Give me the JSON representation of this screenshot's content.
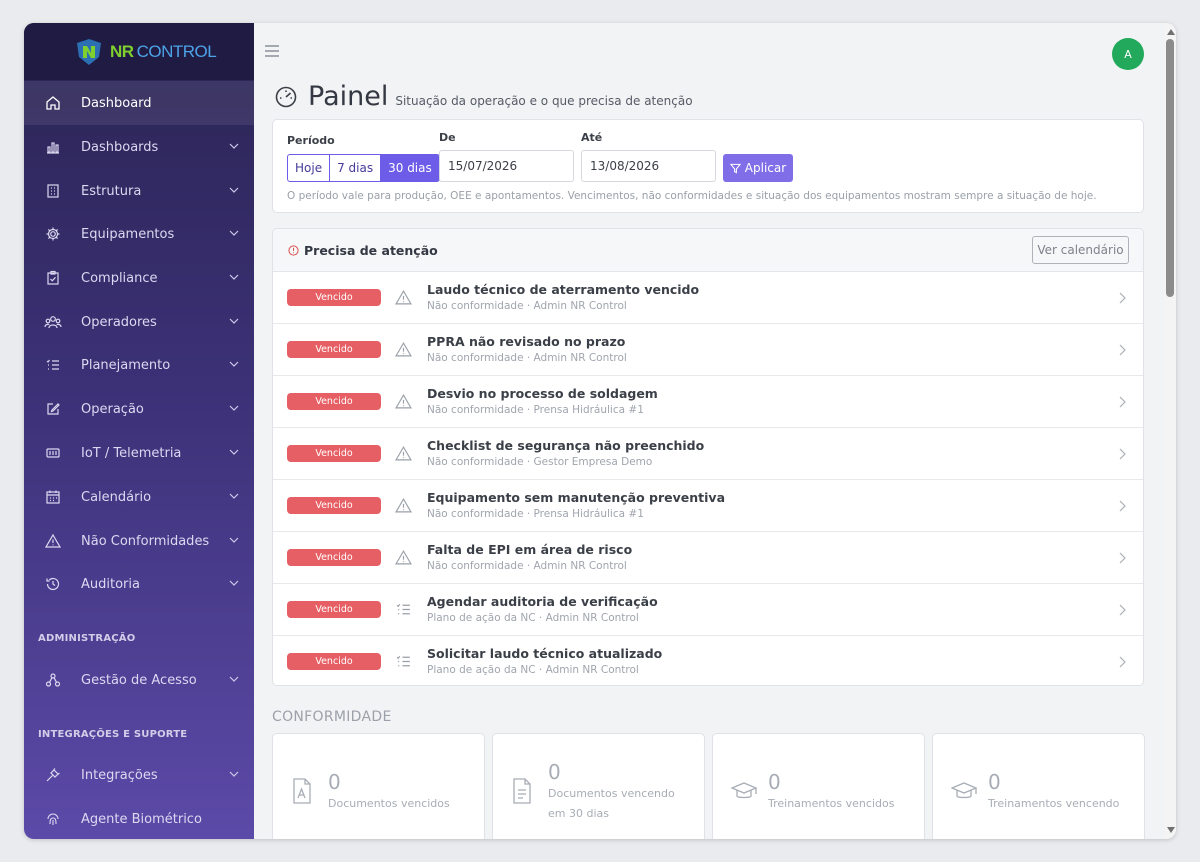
{
  "brand": {
    "part1": "NR",
    "part2": "CONTROL"
  },
  "sidebar": {
    "items": [
      {
        "label": "Dashboard",
        "icon": "home-icon"
      },
      {
        "label": "Dashboards",
        "icon": "bar-chart-icon"
      },
      {
        "label": "Estrutura",
        "icon": "building-icon"
      },
      {
        "label": "Equipamentos",
        "icon": "gear-icon"
      },
      {
        "label": "Compliance",
        "icon": "clipboard-check-icon"
      },
      {
        "label": "Operadores",
        "icon": "users-icon"
      },
      {
        "label": "Planejamento",
        "icon": "list-icon"
      },
      {
        "label": "Operação",
        "icon": "edit-icon"
      },
      {
        "label": "IoT / Telemetria",
        "icon": "chip-icon"
      },
      {
        "label": "Calendário",
        "icon": "calendar-icon"
      },
      {
        "label": "Não Conformidades",
        "icon": "warning-icon"
      },
      {
        "label": "Auditoria",
        "icon": "history-icon"
      }
    ],
    "section_admin": "ADMINISTRAÇÃO",
    "admin_items": [
      {
        "label": "Gestão de Acesso",
        "icon": "diagram-icon"
      }
    ],
    "section_integrations": "INTEGRAÇÕES E SUPORTE",
    "integration_items": [
      {
        "label": "Integrações",
        "icon": "plug-icon"
      },
      {
        "label": "Agente Biométrico",
        "icon": "fingerprint-icon"
      }
    ]
  },
  "header": {
    "avatar_initial": "A"
  },
  "page": {
    "title": "Painel",
    "subtitle": "Situação da operação e o que precisa de atenção"
  },
  "period": {
    "label": "Período",
    "options": [
      "Hoje",
      "7 dias",
      "30 dias"
    ],
    "selected": "30 dias",
    "from_label": "De",
    "from_value": "15/07/2026",
    "to_label": "Até",
    "to_value": "13/08/2026",
    "apply_label": "Aplicar",
    "hint": "O período vale para produção, OEE e apontamentos. Vencimentos, não conformidades e situação dos equipamentos mostram sempre a situação de hoje."
  },
  "attention": {
    "title": "Precisa de atenção",
    "calendar_button": "Ver calendário",
    "rows": [
      {
        "badge": "Vencido",
        "icon": "warning-icon",
        "title": "Laudo técnico de aterramento vencido",
        "sub": "Não conformidade · Admin NR Control"
      },
      {
        "badge": "Vencido",
        "icon": "warning-icon",
        "title": "PPRA não revisado no prazo",
        "sub": "Não conformidade · Admin NR Control"
      },
      {
        "badge": "Vencido",
        "icon": "warning-icon",
        "title": "Desvio no processo de soldagem",
        "sub": "Não conformidade · Prensa Hidráulica #1"
      },
      {
        "badge": "Vencido",
        "icon": "warning-icon",
        "title": "Checklist de segurança não preenchido",
        "sub": "Não conformidade · Gestor Empresa Demo"
      },
      {
        "badge": "Vencido",
        "icon": "warning-icon",
        "title": "Equipamento sem manutenção preventiva",
        "sub": "Não conformidade · Prensa Hidráulica #1"
      },
      {
        "badge": "Vencido",
        "icon": "warning-icon",
        "title": "Falta de EPI em área de risco",
        "sub": "Não conformidade · Admin NR Control"
      },
      {
        "badge": "Vencido",
        "icon": "list-icon",
        "title": "Agendar auditoria de verificação",
        "sub": "Plano de ação da NC · Admin NR Control"
      },
      {
        "badge": "Vencido",
        "icon": "list-icon",
        "title": "Solicitar laudo técnico atualizado",
        "sub": "Plano de ação da NC · Admin NR Control"
      }
    ]
  },
  "compliance": {
    "title": "CONFORMIDADE",
    "cards": [
      {
        "value": "0",
        "label": "Documentos vencidos",
        "icon": "pdf-icon"
      },
      {
        "value": "0",
        "label": "Documentos vencendo em 30 dias",
        "icon": "document-icon"
      },
      {
        "value": "0",
        "label": "Treinamentos vencidos",
        "icon": "graduation-cap-icon"
      },
      {
        "value": "0",
        "label": "Treinamentos vencendo",
        "icon": "graduation-cap-icon"
      }
    ]
  },
  "colors": {
    "accent": "#6c5ce7",
    "danger": "#e65f64",
    "success": "#22a95b",
    "sidebar_dark": "#2a2452",
    "sidebar_light": "#5c4aa8"
  }
}
